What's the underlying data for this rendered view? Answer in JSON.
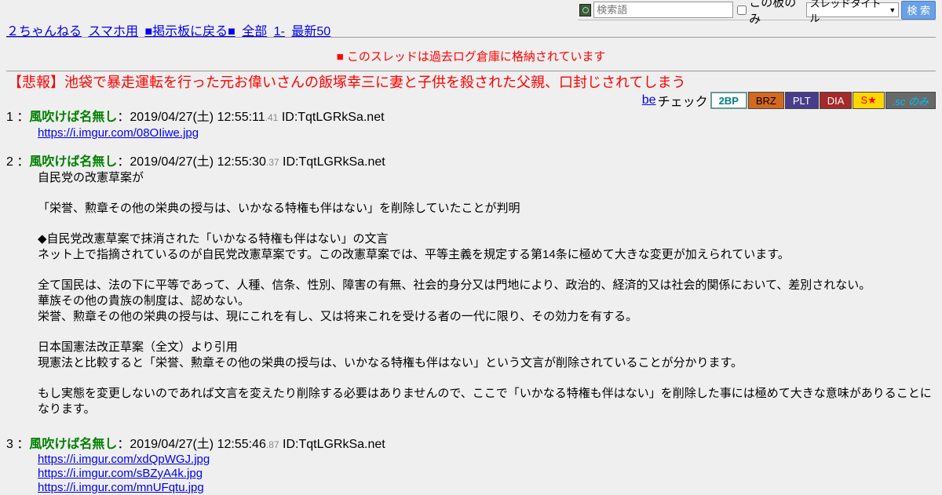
{
  "search": {
    "placeholder": "検索語",
    "board_only_label": "この板のみ",
    "select_value": "スレッドタイトル",
    "button_label": "検 索"
  },
  "nav": {
    "links": [
      "２ちゃんねる",
      "スマホ用",
      "■掲示板に戻る■",
      "全部",
      "1-",
      "最新50"
    ]
  },
  "notice": "■ このスレッドは過去ログ倉庫に格納されています",
  "thread_title": "【悲報】池袋で暴走運転を行った元お偉いさんの飯塚幸三に妻と子供を殺された父親、口封じされてしまう",
  "becheck": {
    "be": "be",
    "check": "チェック",
    "buttons": [
      {
        "label": "2BP",
        "bg": "#ffffff",
        "fg": "#008080"
      },
      {
        "label": "BRZ",
        "bg": "#d2691e",
        "fg": "#000000"
      },
      {
        "label": "PLT",
        "bg": "#483d8b",
        "fg": "#ffffff"
      },
      {
        "label": "DIA",
        "bg": "#a52a2a",
        "fg": "#ffffff"
      },
      {
        "label": "S★",
        "bg": "#ffd700",
        "fg": "#ff0000"
      },
      {
        "label": ".sc のみ",
        "bg": "#696969",
        "fg": "#00bfff"
      }
    ]
  },
  "posts": [
    {
      "num": "1",
      "name": "風吹けば名無し",
      "date": "2019/04/27(土) 12:55:11",
      "ms": ".41",
      "id": "ID:TqtLGRkSa.net",
      "links": [
        "https://i.imgur.com/08OIiwe.jpg"
      ]
    },
    {
      "num": "2",
      "name": "風吹けば名無し",
      "date": "2019/04/27(土) 12:55:30",
      "ms": ".37",
      "id": "ID:TqtLGRkSa.net",
      "lines": [
        "自民党の改憲草案が",
        "",
        "「栄誉、勲章その他の栄典の授与は、いかなる特権も伴はない」を削除していたことが判明",
        "",
        "◆自民党改憲草案で抹消された「いかなる特権も伴はない」の文言",
        "ネット上で指摘されているのが自民党改憲草案です。この改憲草案では、平等主義を規定する第14条に極めて大きな変更が加えられています。",
        "",
        "全て国民は、法の下に平等であって、人種、信条、性別、障害の有無、社会的身分又は門地により、政治的、経済的又は社会的関係において、差別されない。",
        "華族その他の貴族の制度は、認めない。",
        "栄誉、勲章その他の栄典の授与は、現にこれを有し、又は将来これを受ける者の一代に限り、その効力を有する。",
        "",
        "日本国憲法改正草案（全文）より引用",
        "現憲法と比較すると「栄誉、勲章その他の栄典の授与は、いかなる特権も伴はない」という文言が削除されていることが分かります。",
        "",
        "もし実態を変更しないのであれば文言を変えたり削除する必要はありませんので、ここで「いかなる特権も伴はない」を削除した事には極めて大きな意味がありることになります。"
      ]
    },
    {
      "num": "3",
      "name": "風吹けば名無し",
      "date": "2019/04/27(土) 12:55:46",
      "ms": ".87",
      "id": "ID:TqtLGRkSa.net",
      "links": [
        "https://i.imgur.com/xdQpWGJ.jpg",
        "https://i.imgur.com/sBZyA4k.jpg",
        "https://i.imgur.com/mnUFqtu.jpg"
      ]
    }
  ]
}
